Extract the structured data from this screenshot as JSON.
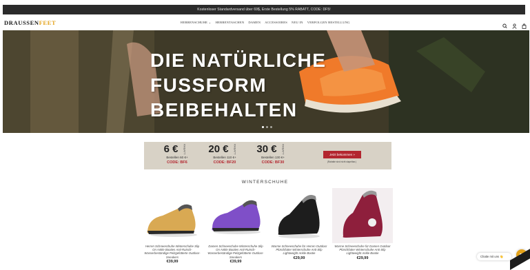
{
  "announcement": "Kostenloser Standardversand über 69$, Erste Bestellung 5% RABATT, CODE: DF5!",
  "logo": {
    "part1": "DRAUSSEN",
    "part2": "FEET"
  },
  "nav": [
    "HERRENSCHUHE ⌄",
    "HERRENTASCHEN",
    "DAMEN",
    "ACCESSOIRES",
    "NEU IN",
    "VERFOLGEN BESTELLUNG"
  ],
  "header_icons": [
    "search-icon",
    "account-icon",
    "cart-icon"
  ],
  "hero": {
    "line1": "DIE NATÜRLICHE",
    "line2": "FUSSFORM",
    "line3": "BEIBEHALTEN",
    "slides": 3,
    "active_slide": 1
  },
  "promo": {
    "coupons": [
      {
        "amount": "6 €",
        "tag": "RABATT",
        "min": "Bestellen 60 €+",
        "code": "CODE: BF6"
      },
      {
        "amount": "20 €",
        "tag": "RABATT",
        "min": "Bestellen 110 €+",
        "code": "CODE: BF20"
      },
      {
        "amount": "30 €",
        "tag": "RABATT",
        "min": "Bestellen 130 €+",
        "code": "CODE: BF30"
      }
    ],
    "button": "Jetzt bekommen »",
    "note": "(Rabatte sind nicht stapelbar.)"
  },
  "section_title": "WINTERSCHUHE",
  "products": [
    {
      "name": "Herren Schneeschuhe Winterschuhe Slip On Ankle Booties Anti-Rutsch-Wasserbeständige Pelzgefütterte Outdoor-Sneakers",
      "price": "€39,99",
      "color": "#d9a953"
    },
    {
      "name": "Damen Schneeschuhe Winterschuhe Slip On Ankle Booties Anti-Rutsch-Wasserbeständige Pelzgefütterte Outdoor-Sneakers",
      "price": "€39,99",
      "color": "#7f4fc8"
    },
    {
      "name": "Warme Schneeschuhe für Herren Outdoor Plüschfutter Winterschuhe Anti-Slip Lightweight Ankle Bootie",
      "price": "€29,99",
      "color": "#1d1d1d"
    },
    {
      "name": "Warme Schneeschuhe für Damen Outdoor Plüschfutter Winterschuhe Anti-Slip Lightweight Ankle Bootie",
      "price": "€29,99",
      "color": "#8e1f3c"
    }
  ],
  "chat_label": "Chatte mit uns 👋"
}
